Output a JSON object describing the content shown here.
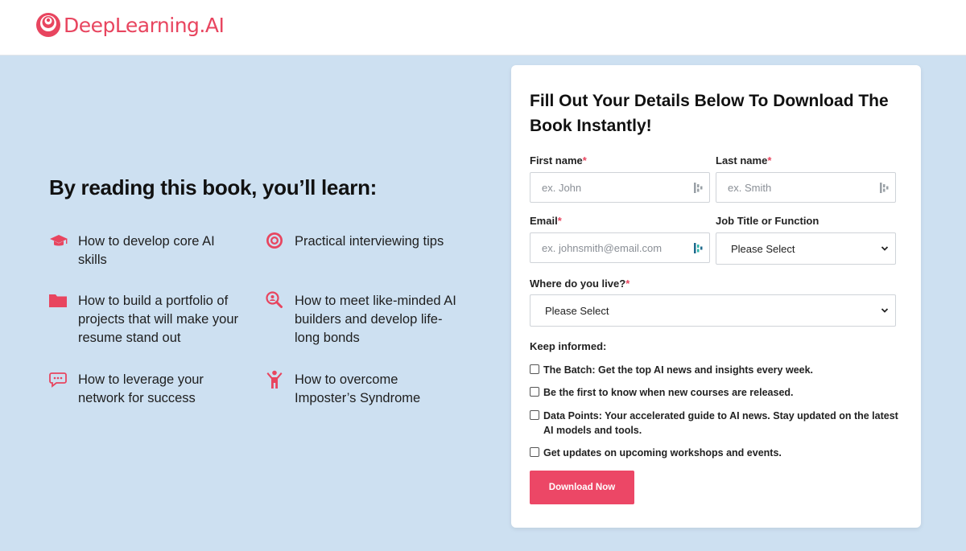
{
  "header": {
    "brand": "DeepLearning.AI"
  },
  "learn": {
    "heading": "By reading this book, you’ll learn:",
    "items": [
      {
        "text": "How to develop core AI skills",
        "icon": "graduation-cap-icon"
      },
      {
        "text": "Practical interviewing tips",
        "icon": "target-icon"
      },
      {
        "text": "How to build a portfolio of projects that will make your resume stand out",
        "icon": "folder-icon"
      },
      {
        "text": "How to meet like-minded AI builders and develop life-long bonds",
        "icon": "search-people-icon"
      },
      {
        "text": "How to leverage your network for success",
        "icon": "chat-bubble-icon"
      },
      {
        "text": "How to overcome Imposter’s Syndrome",
        "icon": "person-cheer-icon"
      }
    ]
  },
  "form": {
    "title": "Fill Out Your Details Below To Download The Book Instantly!",
    "first_name": {
      "label": "First name",
      "required": "*",
      "placeholder": "ex. John",
      "value": ""
    },
    "last_name": {
      "label": "Last name",
      "required": "*",
      "placeholder": "ex. Smith",
      "value": ""
    },
    "email": {
      "label": "Email",
      "required": "*",
      "placeholder": "ex. johnsmith@email.com",
      "value": ""
    },
    "job": {
      "label": "Job Title or Function",
      "selected": "Please Select"
    },
    "location": {
      "label": "Where do you live?",
      "required": "*",
      "selected": "Please Select"
    },
    "keep_informed": "Keep informed:",
    "checkboxes": [
      {
        "label": "The Batch: Get the top AI news and insights every week.",
        "checked": false
      },
      {
        "label": "Be the first to know when new courses are released.",
        "checked": false
      },
      {
        "label": "Data Points: Your accelerated guide to AI news. Stay updated on the latest AI models and tools.",
        "checked": false
      },
      {
        "label": "Get updates on upcoming workshops and events.",
        "checked": false
      }
    ],
    "submit": "Download Now"
  },
  "colors": {
    "brand": "#e8455f",
    "hero_bg": "#cde0f1",
    "button": "#ec4766",
    "card": "#ffffff"
  }
}
